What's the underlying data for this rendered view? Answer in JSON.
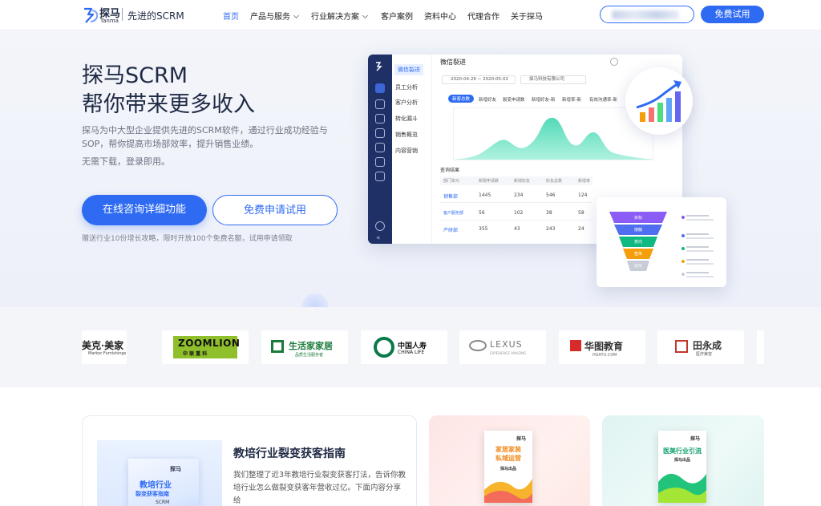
{
  "nav": {
    "logo_cn": "探马",
    "logo_en": "Tanma",
    "slogan": "先进的SCRM",
    "items": [
      {
        "label": "首页",
        "active": true,
        "dropdown": false
      },
      {
        "label": "产品与服务",
        "active": false,
        "dropdown": true
      },
      {
        "label": "行业解决方案",
        "active": false,
        "dropdown": true
      },
      {
        "label": "客户案例",
        "active": false,
        "dropdown": false
      },
      {
        "label": "资料中心",
        "active": false,
        "dropdown": false
      },
      {
        "label": "代理合作",
        "active": false,
        "dropdown": false
      },
      {
        "label": "关于探马",
        "active": false,
        "dropdown": false
      }
    ],
    "trial_button": "免费试用"
  },
  "hero": {
    "title_line1": "探马SCRM",
    "title_line2": "帮你带来更多收入",
    "desc_line1": "探马为中大型企业提供先进的SCRM软件，通过行业成功经验与",
    "desc_line2": "SOP，帮你提高市场部效率，提升销售业绩。",
    "note": "无需下载，登录即用。",
    "consult_button": "在线咨询详细功能",
    "apply_button": "免费申请试用",
    "small_note": "赠送行业10份增长攻略，限时开放100个免费名额，试用申请领取"
  },
  "dashboard": {
    "side_items": [
      "微信裂进",
      "员工分析",
      "客户分析",
      "转化漏斗",
      "销售概览",
      "内容营销"
    ],
    "title": "微信裂进",
    "date_range": "2020-04-26 ~ 2020-05-02",
    "company": "探马科技有限公司",
    "tabs": [
      "新客总数",
      "新增好友",
      "裂变申请数",
      "新增好友-新",
      "新增率-新",
      "有效沟通率-新"
    ],
    "table_title": "查询结果",
    "table_headers": [
      "部门单元",
      "新裂申请数",
      "新增好友",
      "好友总数",
      "新增率"
    ],
    "table_rows": [
      [
        "销售部",
        "1445",
        "234",
        "546",
        "124"
      ],
      [
        "客户服务部",
        "56",
        "102",
        "38",
        "58"
      ],
      [
        "产研部",
        "355",
        "43",
        "243",
        "24"
      ]
    ],
    "funnel_levels": [
      "目标",
      "接触",
      "意向",
      "签单",
      "成交"
    ],
    "funnel_colors": [
      "#8b5cf6",
      "#4f6ef0",
      "#10b981",
      "#f59e0b",
      "#c7ccd6"
    ]
  },
  "brands": [
    {
      "name": "美克·美家",
      "sub": "Markor Furnishings"
    },
    {
      "name": "ZOOMLION",
      "sub": "中 联 重 科"
    },
    {
      "name": "生活家家居",
      "sub": "品质生活服务者"
    },
    {
      "name": "中国人寿",
      "sub": "CHINA LIFE"
    },
    {
      "name": "LEXUS",
      "sub": "EXPERIENCE AMAZING"
    },
    {
      "name": "华图教育",
      "sub": "HUATU.COM"
    },
    {
      "name": "田永成",
      "sub": "医疗美容"
    }
  ],
  "cards": {
    "card1_title": "教培行业裂变获客指南",
    "card1_desc": "我们整理了近3年教培行业裂变获客打法，告诉你教培行业怎么做裂变获客年营收过亿。下面内容分享给",
    "book1_logo": "探马",
    "book1_title1": "教培行业",
    "book1_title2": "裂变获客指南",
    "book1_tag": "SCRM",
    "card2_book_title1": "家居家装",
    "card2_book_title2": "私域运营",
    "card2_book_tag": "探马出品",
    "card3_book_title1": "医美行业引流",
    "card3_book_tag": "探马出品"
  }
}
